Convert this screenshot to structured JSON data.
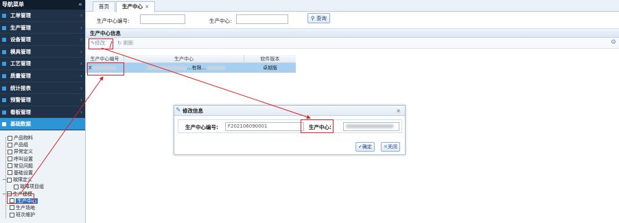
{
  "sidebar": {
    "header": "导航菜单",
    "collapse_icon": "double-chevron-left-icon",
    "items": [
      {
        "label": "工单管理",
        "icon": "list-icon"
      },
      {
        "label": "生产管理",
        "icon": "gear-icon"
      },
      {
        "label": "设备管理",
        "icon": "bar-chart-icon"
      },
      {
        "label": "模具管理",
        "icon": "grid-icon"
      },
      {
        "label": "工艺管理",
        "icon": "heart-icon"
      },
      {
        "label": "质量管理",
        "icon": "shield-icon"
      },
      {
        "label": "统计报表",
        "icon": "line-chart-icon"
      },
      {
        "label": "预警管理",
        "icon": "alarm-icon"
      },
      {
        "label": "看板管理",
        "icon": "monitor-icon"
      },
      {
        "label": "基础数据",
        "icon": "database-icon"
      }
    ],
    "tree": [
      {
        "label": "产品物料",
        "indent": 0
      },
      {
        "label": "产品组",
        "indent": 0
      },
      {
        "label": "异常定义",
        "indent": 0
      },
      {
        "label": "呼叫设置",
        "indent": 0
      },
      {
        "label": "常见问题",
        "indent": 0
      },
      {
        "label": "基础设置",
        "indent": 0
      },
      {
        "label": "故障定义",
        "indent": 0,
        "expander": "−"
      },
      {
        "label": "故障项目组",
        "indent": 1
      },
      {
        "label": "生产建模",
        "indent": 0,
        "expander": "−"
      },
      {
        "label": "生产中心",
        "indent": 1,
        "selected": true
      },
      {
        "label": "生产场地",
        "indent": 1
      },
      {
        "label": "班次维护",
        "indent": 1
      }
    ]
  },
  "tabs": {
    "home": "首页",
    "current": "生产中心",
    "close": "×"
  },
  "search": {
    "code_label": "生产中心编号:",
    "name_label": "生产中心:",
    "button": "查询",
    "button_icon": "search-icon"
  },
  "panel": {
    "title": "生产中心信息",
    "edit": "修改",
    "refresh": "刷新",
    "settings_icon": "gear-icon"
  },
  "grid": {
    "columns": [
      "生产中心编号",
      "生产中心",
      "软件版本"
    ],
    "rows": [
      {
        "code": "X",
        "name": "…有限…",
        "version": "卓越版"
      }
    ]
  },
  "modal": {
    "title": "修改信息",
    "close": "×",
    "code_label": "生产中心编号:",
    "code_value": "F202106090001",
    "name_label": "生产中心:",
    "ok": "确定",
    "cancel": "关闭"
  },
  "colors": {
    "annotation": "#e02020",
    "sidebar_bg": "#1a2b3f",
    "active_item": "#2b95d6",
    "selected_row": "#a6cff0"
  }
}
